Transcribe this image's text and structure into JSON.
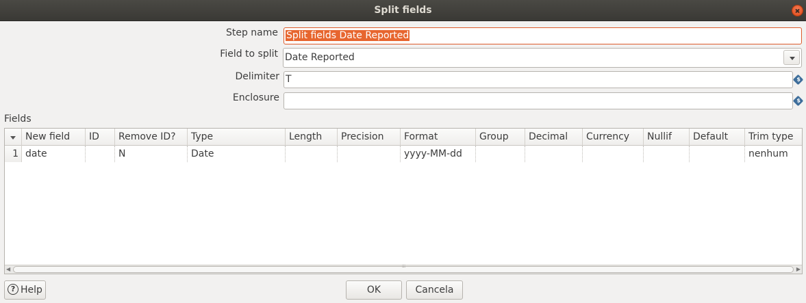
{
  "window": {
    "title": "Split fields"
  },
  "form": {
    "step_name_label": "Step name",
    "step_name_value": "Split fields Date Reported",
    "field_to_split_label": "Field to split",
    "field_to_split_value": "Date Reported",
    "delimiter_label": "Delimiter",
    "delimiter_value": "T",
    "enclosure_label": "Enclosure",
    "enclosure_value": ""
  },
  "fields_section": {
    "label": "Fields",
    "columns": [
      "New field",
      "ID",
      "Remove ID?",
      "Type",
      "Length",
      "Precision",
      "Format",
      "Group",
      "Decimal",
      "Currency",
      "Nullif",
      "Default",
      "Trim type"
    ],
    "rows": [
      {
        "num": "1",
        "cells": [
          "date",
          "",
          "N",
          "Date",
          "",
          "",
          "yyyy-MM-dd",
          "",
          "",
          "",
          "",
          "",
          "nenhum"
        ]
      }
    ]
  },
  "buttons": {
    "help": "Help",
    "ok": "OK",
    "cancel": "Cancela"
  },
  "icons": {
    "variable": "variable-icon",
    "help": "help-icon",
    "close": "close-icon"
  },
  "colors": {
    "accent": "#dd4814",
    "selection": "#e7662f",
    "titlebar": "#3c3b37"
  }
}
